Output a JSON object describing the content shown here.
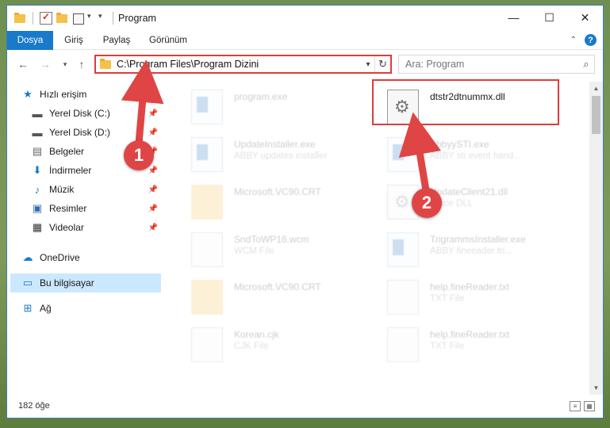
{
  "titlebar": {
    "title": "Program"
  },
  "window_controls": {
    "minimize": "—",
    "maximize": "☐",
    "close": "✕"
  },
  "ribbon": {
    "tabs": [
      "Dosya",
      "Giriş",
      "Paylaş",
      "Görünüm"
    ],
    "help": "?"
  },
  "address": {
    "path": "C:\\Program Files\\Program Dizini"
  },
  "search": {
    "placeholder": "Ara: Program"
  },
  "sidebar": {
    "items": [
      {
        "label": "Hızlı erişim",
        "icon": "star-icon"
      },
      {
        "label": "Yerel Disk (C:)",
        "icon": "drive-icon",
        "pinned": true
      },
      {
        "label": "Yerel Disk (D:)",
        "icon": "drive-icon",
        "pinned": true
      },
      {
        "label": "Belgeler",
        "icon": "documents-icon",
        "pinned": true
      },
      {
        "label": "İndirmeler",
        "icon": "download-icon",
        "pinned": true
      },
      {
        "label": "Müzik",
        "icon": "music-icon",
        "pinned": true
      },
      {
        "label": "Resimler",
        "icon": "pictures-icon",
        "pinned": true
      },
      {
        "label": "Videolar",
        "icon": "videos-icon",
        "pinned": true
      },
      {
        "label": "OneDrive",
        "icon": "cloud-icon"
      },
      {
        "label": "Bu bilgisayar",
        "icon": "computer-icon",
        "selected": true
      },
      {
        "label": "Ağ",
        "icon": "network-icon"
      }
    ]
  },
  "files": [
    {
      "name": "program.exe",
      "sub": "",
      "type": "exe"
    },
    {
      "name": "dtstr2dtnummx.dll",
      "sub": "",
      "type": "dll"
    },
    {
      "name": "UpdateInstaller.exe",
      "sub": "ABBY updates installer",
      "type": "exe"
    },
    {
      "name": "AbbyySTI.exe",
      "sub": "ABBY sti event hand...",
      "type": "exe"
    },
    {
      "name": "Microsoft.VC90.CRT",
      "sub": "",
      "type": "folder"
    },
    {
      "name": "UpdateClient21.dll",
      "sub": "Office DLL",
      "type": "dll"
    },
    {
      "name": "SndToWP16.wcm",
      "sub": "WCM File",
      "type": "file"
    },
    {
      "name": "TrigrammsInstaller.exe",
      "sub": "ABBY fineeader tri...",
      "type": "exe"
    },
    {
      "name": "Microsoft.VC90.CRT",
      "sub": "",
      "type": "folder"
    },
    {
      "name": "help.fineReader.txt",
      "sub": "TXT File",
      "type": "file"
    },
    {
      "name": "Korean.cjk",
      "sub": "CJK File",
      "type": "file"
    },
    {
      "name": "help.fineReader.txt",
      "sub": "TXT File",
      "type": "file"
    }
  ],
  "status": {
    "count": "182 öğe"
  },
  "markers": [
    "1",
    "2"
  ],
  "colors": {
    "accent": "#1979ca",
    "highlight": "#e03b3b",
    "marker": "#e04545"
  }
}
